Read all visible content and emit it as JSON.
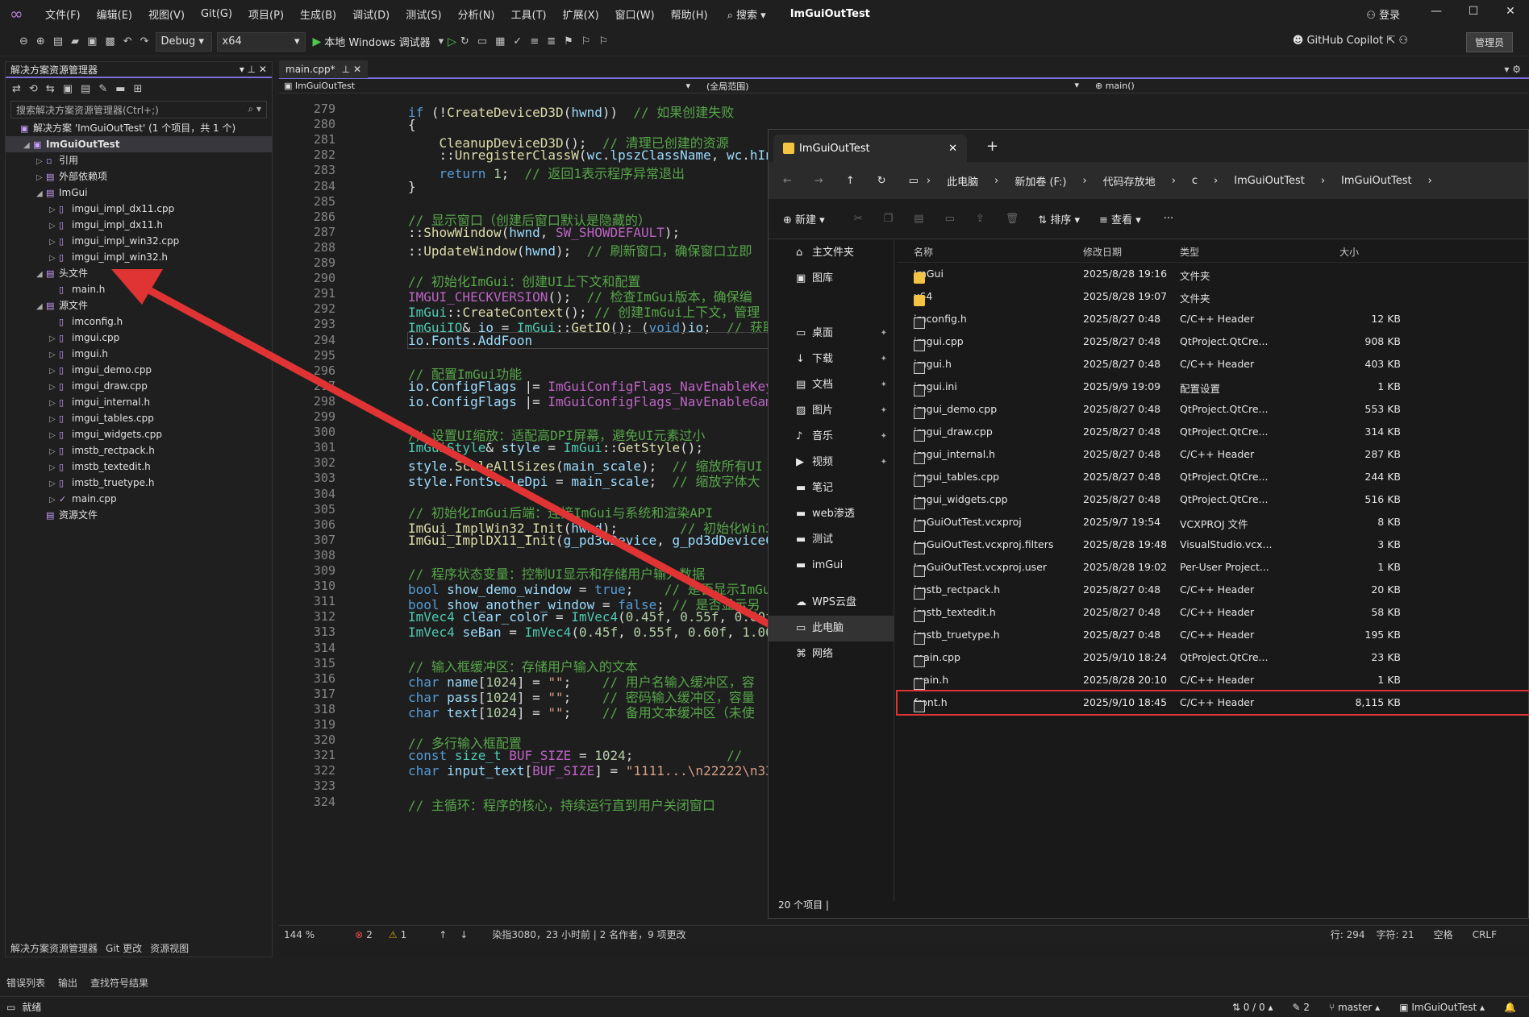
{
  "menu": [
    "文件(F)",
    "编辑(E)",
    "视图(V)",
    "Git(G)",
    "项目(P)",
    "生成(B)",
    "调试(D)",
    "测试(S)",
    "分析(N)",
    "工具(T)",
    "扩展(X)",
    "窗口(W)",
    "帮助(H)"
  ],
  "search_label": "搜索",
  "window_title": "ImGuiOutTest",
  "login": "登录",
  "toolbar": {
    "config": "Debug",
    "platform": "x64",
    "debugger": "本地 Windows 调试器",
    "copilot": "GitHub Copilot",
    "admin": "管理员"
  },
  "solution_explorer": {
    "title": "解决方案资源管理器",
    "search_placeholder": "搜索解决方案资源管理器(Ctrl+;)",
    "items": [
      {
        "label": "解决方案 'ImGuiOutTest' (1 个项目，共 1 个)",
        "indent": 0,
        "arrow": "",
        "icon": "▣"
      },
      {
        "label": "ImGuiOutTest",
        "indent": 1,
        "arrow": "◢",
        "icon": "▣",
        "sel": true
      },
      {
        "label": "引用",
        "indent": 2,
        "arrow": "▷",
        "icon": "▫"
      },
      {
        "label": "外部依赖项",
        "indent": 2,
        "arrow": "▷",
        "icon": "▤"
      },
      {
        "label": "ImGui",
        "indent": 2,
        "arrow": "◢",
        "icon": "▤"
      },
      {
        "label": "imgui_impl_dx11.cpp",
        "indent": 3,
        "arrow": "▷",
        "icon": "▯"
      },
      {
        "label": "imgui_impl_dx11.h",
        "indent": 3,
        "arrow": "▷",
        "icon": "▯"
      },
      {
        "label": "imgui_impl_win32.cpp",
        "indent": 3,
        "arrow": "▷",
        "icon": "▯"
      },
      {
        "label": "imgui_impl_win32.h",
        "indent": 3,
        "arrow": "▷",
        "icon": "▯"
      },
      {
        "label": "头文件",
        "indent": 2,
        "arrow": "◢",
        "icon": "▤"
      },
      {
        "label": "main.h",
        "indent": 3,
        "arrow": "",
        "icon": "▯"
      },
      {
        "label": "源文件",
        "indent": 2,
        "arrow": "◢",
        "icon": "▤"
      },
      {
        "label": "imconfig.h",
        "indent": 3,
        "arrow": "",
        "icon": "▯"
      },
      {
        "label": "imgui.cpp",
        "indent": 3,
        "arrow": "▷",
        "icon": "▯"
      },
      {
        "label": "imgui.h",
        "indent": 3,
        "arrow": "▷",
        "icon": "▯"
      },
      {
        "label": "imgui_demo.cpp",
        "indent": 3,
        "arrow": "▷",
        "icon": "▯"
      },
      {
        "label": "imgui_draw.cpp",
        "indent": 3,
        "arrow": "▷",
        "icon": "▯"
      },
      {
        "label": "imgui_internal.h",
        "indent": 3,
        "arrow": "▷",
        "icon": "▯"
      },
      {
        "label": "imgui_tables.cpp",
        "indent": 3,
        "arrow": "▷",
        "icon": "▯"
      },
      {
        "label": "imgui_widgets.cpp",
        "indent": 3,
        "arrow": "▷",
        "icon": "▯"
      },
      {
        "label": "imstb_rectpack.h",
        "indent": 3,
        "arrow": "▷",
        "icon": "▯"
      },
      {
        "label": "imstb_textedit.h",
        "indent": 3,
        "arrow": "▷",
        "icon": "▯"
      },
      {
        "label": "imstb_truetype.h",
        "indent": 3,
        "arrow": "▷",
        "icon": "▯"
      },
      {
        "label": "main.cpp",
        "indent": 3,
        "arrow": "▷",
        "icon": "✓"
      },
      {
        "label": "资源文件",
        "indent": 2,
        "arrow": "",
        "icon": "▤"
      }
    ],
    "bottom_tabs": [
      "解决方案资源管理器",
      "Git 更改",
      "资源视图"
    ]
  },
  "editor": {
    "tab": "main.cpp*",
    "nav_project": "ImGuiOutTest",
    "nav_scope": "(全局范围)",
    "nav_func": "main()",
    "zoom": "144 %",
    "errors": "2",
    "warnings": "1",
    "git_info": "染指3080，23 小时前 | 2 名作者，9 项更改",
    "pos_line": "行: 294",
    "pos_char": "字符: 21",
    "ws": "空格",
    "eol": "CRLF"
  },
  "code_lines": [
    {
      "n": "279",
      "html": "<span class='k'>if</span> (!<span class='f'>CreateDeviceD3D</span>(<span class='v'>hwnd</span>))  <span class='c'>// 如果创建失败</span>"
    },
    {
      "n": "280",
      "html": "{"
    },
    {
      "n": "281",
      "html": "    <span class='f'>CleanupDeviceD3D</span>();  <span class='c'>// 清理已创建的资源</span>"
    },
    {
      "n": "282",
      "html": "    ::<span class='f'>UnregisterClassW</span>(<span class='v'>wc</span>.<span class='v'>lpszClassName</span>, <span class='v'>wc</span>.<span class='v'>hIns</span>"
    },
    {
      "n": "283",
      "html": "    <span class='k'>return</span> <span class='n'>1</span>;  <span class='c'>// 返回1表示程序异常退出</span>"
    },
    {
      "n": "284",
      "html": "}"
    },
    {
      "n": "285",
      "html": ""
    },
    {
      "n": "286",
      "html": "<span class='c'>// 显示窗口（创建后窗口默认是隐藏的）</span>"
    },
    {
      "n": "287",
      "html": "::<span class='f'>ShowWindow</span>(<span class='v'>hwnd</span>, <span class='m'>SW_SHOWDEFAULT</span>);"
    },
    {
      "n": "288",
      "html": "::<span class='f'>UpdateWindow</span>(<span class='v'>hwnd</span>);  <span class='c'>// 刷新窗口，确保窗口立即</span>"
    },
    {
      "n": "289",
      "html": ""
    },
    {
      "n": "290",
      "html": "<span class='c'>// 初始化ImGui：创建UI上下文和配置</span>"
    },
    {
      "n": "291",
      "html": "<span class='m'>IMGUI_CHECKVERSION</span>();  <span class='c'>// 检查ImGui版本，确保编</span>"
    },
    {
      "n": "292",
      "html": "<span class='t2'>ImGui</span>::<span class='f'>CreateContext</span>(); <span class='c'>// 创建ImGui上下文，管理</span>"
    },
    {
      "n": "293",
      "html": "<span class='t2'>ImGuiIO</span>&amp; <span class='v'>io</span> = <span class='t2'>ImGui</span>::<span class='f'>GetIO</span>(); (<span class='k'>void</span>)<span class='v'>io</span>;  <span class='c'>// 获取</span>"
    },
    {
      "n": "294",
      "html": "<span class='v'>io</span>.<span class='v'>Fonts</span>.<span class='v'>AddFoon</span>"
    },
    {
      "n": "295",
      "html": ""
    },
    {
      "n": "296",
      "html": "<span class='c'>// 配置ImGui功能</span>"
    },
    {
      "n": "297",
      "html": "<span class='v'>io</span>.<span class='v'>ConfigFlags</span> |= <span class='m'>ImGuiConfigFlags_NavEnableKeyb</span>"
    },
    {
      "n": "298",
      "html": "<span class='v'>io</span>.<span class='v'>ConfigFlags</span> |= <span class='m'>ImGuiConfigFlags_NavEnableGame</span>"
    },
    {
      "n": "299",
      "html": ""
    },
    {
      "n": "300",
      "html": "<span class='c'>// 设置UI缩放：适配高DPI屏幕，避免UI元素过小</span>"
    },
    {
      "n": "301",
      "html": "<span class='t2'>ImGuiStyle</span>&amp; <span class='v'>style</span> = <span class='t2'>ImGui</span>::<span class='f'>GetStyle</span>();"
    },
    {
      "n": "302",
      "html": "<span class='v'>style</span>.<span class='f'>ScaleAllSizes</span>(<span class='v'>main_scale</span>);  <span class='c'>// 缩放所有UI</span>"
    },
    {
      "n": "303",
      "html": "<span class='v'>style</span>.<span class='v'>FontScaleDpi</span> = <span class='v'>main_scale</span>;  <span class='c'>// 缩放字体大</span>"
    },
    {
      "n": "304",
      "html": ""
    },
    {
      "n": "305",
      "html": "<span class='c'>// 初始化ImGui后端：连接ImGui与系统和渲染API</span>"
    },
    {
      "n": "306",
      "html": "<span class='f'>ImGui_ImplWin32_Init</span>(<span class='v'>hwnd</span>);        <span class='c'>// 初始化Win32</span>"
    },
    {
      "n": "307",
      "html": "<span class='f'>ImGui_ImplDX11_Init</span>(<span class='v'>g_pd3dDevice</span>, <span class='v'>g_pd3dDeviceCo</span>"
    },
    {
      "n": "308",
      "html": ""
    },
    {
      "n": "309",
      "html": "<span class='c'>// 程序状态变量：控制UI显示和存储用户输入数据</span>"
    },
    {
      "n": "310",
      "html": "<span class='k'>bool</span> <span class='v'>show_demo_window</span> = <span class='k'>true</span>;    <span class='c'>// 是否显示ImGu</span>"
    },
    {
      "n": "311",
      "html": "<span class='k'>bool</span> <span class='v'>show_another_window</span> = <span class='k'>false</span>; <span class='c'>// 是否显示另</span>"
    },
    {
      "n": "312",
      "html": "<span class='t2'>ImVec4</span> <span class='v'>clear_color</span> = <span class='t2'>ImVec4</span>(<span class='n'>0.45f</span>, <span class='n'>0.55f</span>, <span class='n'>0.60f</span>,"
    },
    {
      "n": "313",
      "html": "<span class='t2'>ImVec4</span> <span class='v'>seBan</span> = <span class='t2'>ImVec4</span>(<span class='n'>0.45f</span>, <span class='n'>0.55f</span>, <span class='n'>0.60f</span>, <span class='n'>1.00f</span>"
    },
    {
      "n": "314",
      "html": ""
    },
    {
      "n": "315",
      "html": "<span class='c'>// 输入框缓冲区：存储用户输入的文本</span>"
    },
    {
      "n": "316",
      "html": "<span class='k'>char</span> <span class='v'>name</span>[<span class='n'>1024</span>] = <span class='s'>\"\"</span>;    <span class='c'>// 用户名输入缓冲区，容</span>"
    },
    {
      "n": "317",
      "html": "<span class='k'>char</span> <span class='v'>pass</span>[<span class='n'>1024</span>] = <span class='s'>\"\"</span>;    <span class='c'>// 密码输入缓冲区，容量</span>"
    },
    {
      "n": "318",
      "html": "<span class='k'>char</span> <span class='v'>text</span>[<span class='n'>1024</span>] = <span class='s'>\"\"</span>;    <span class='c'>// 备用文本缓冲区（未使</span>"
    },
    {
      "n": "319",
      "html": ""
    },
    {
      "n": "320",
      "html": "<span class='c'>// 多行输入框配置</span>"
    },
    {
      "n": "321",
      "html": "<span class='k'>const</span> <span class='t2'>size_t</span> <span class='m'>BUF_SIZE</span> = <span class='n'>1024</span>;            <span class='c'>//</span>"
    },
    {
      "n": "322",
      "html": "<span class='k'>char</span> <span class='v'>input_text</span>[<span class='m'>BUF_SIZE</span>] = <span class='s'>\"1111...\\n22222\\n333</span>"
    },
    {
      "n": "323",
      "html": ""
    },
    {
      "n": "324",
      "html": "<span class='c'>// 主循环：程序的核心，持续运行直到用户关闭窗口</span>"
    }
  ],
  "file_explorer": {
    "tab_title": "ImGuiOutTest",
    "breadcrumb": [
      "此电脑",
      "新加卷 (F:)",
      "代码存放地",
      "c",
      "ImGuiOutTest",
      "ImGuiOutTest"
    ],
    "cmd_new": "新建",
    "cmd_sort": "排序",
    "cmd_view": "查看",
    "headers": [
      "名称",
      "修改日期",
      "类型",
      "大小"
    ],
    "nav": [
      {
        "label": "主文件夹",
        "icon": "⌂",
        "pin": false
      },
      {
        "label": "图库",
        "icon": "▣",
        "pin": false
      },
      {
        "label": "桌面",
        "icon": "▭",
        "pin": true
      },
      {
        "label": "下载",
        "icon": "↓",
        "pin": true
      },
      {
        "label": "文档",
        "icon": "▤",
        "pin": true
      },
      {
        "label": "图片",
        "icon": "▨",
        "pin": true
      },
      {
        "label": "音乐",
        "icon": "♪",
        "pin": true
      },
      {
        "label": "视频",
        "icon": "▶",
        "pin": true
      },
      {
        "label": "笔记",
        "icon": "▬",
        "pin": false
      },
      {
        "label": "web渗透",
        "icon": "▬",
        "pin": false
      },
      {
        "label": "测试",
        "icon": "▬",
        "pin": false
      },
      {
        "label": "imGui",
        "icon": "▬",
        "pin": false
      },
      {
        "label": "WPS云盘",
        "icon": "☁",
        "pin": false
      },
      {
        "label": "此电脑",
        "icon": "▭",
        "pin": false
      },
      {
        "label": "网络",
        "icon": "⌘",
        "pin": false
      }
    ],
    "files": [
      {
        "name": "ImGui",
        "date": "2025/8/28 19:16",
        "type": "文件夹",
        "size": "",
        "folder": true
      },
      {
        "name": "x64",
        "date": "2025/8/28 19:07",
        "type": "文件夹",
        "size": "",
        "folder": true
      },
      {
        "name": "imconfig.h",
        "date": "2025/8/27 0:48",
        "type": "C/C++ Header",
        "size": "12 KB"
      },
      {
        "name": "imgui.cpp",
        "date": "2025/8/27 0:48",
        "type": "QtProject.QtCre...",
        "size": "908 KB"
      },
      {
        "name": "imgui.h",
        "date": "2025/8/27 0:48",
        "type": "C/C++ Header",
        "size": "403 KB"
      },
      {
        "name": "imgui.ini",
        "date": "2025/9/9 19:09",
        "type": "配置设置",
        "size": "1 KB"
      },
      {
        "name": "imgui_demo.cpp",
        "date": "2025/8/27 0:48",
        "type": "QtProject.QtCre...",
        "size": "553 KB"
      },
      {
        "name": "imgui_draw.cpp",
        "date": "2025/8/27 0:48",
        "type": "QtProject.QtCre...",
        "size": "314 KB"
      },
      {
        "name": "imgui_internal.h",
        "date": "2025/8/27 0:48",
        "type": "C/C++ Header",
        "size": "287 KB"
      },
      {
        "name": "imgui_tables.cpp",
        "date": "2025/8/27 0:48",
        "type": "QtProject.QtCre...",
        "size": "244 KB"
      },
      {
        "name": "imgui_widgets.cpp",
        "date": "2025/8/27 0:48",
        "type": "QtProject.QtCre...",
        "size": "516 KB"
      },
      {
        "name": "ImGuiOutTest.vcxproj",
        "date": "2025/9/7 19:54",
        "type": "VCXPROJ 文件",
        "size": "8 KB"
      },
      {
        "name": "ImGuiOutTest.vcxproj.filters",
        "date": "2025/8/28 19:48",
        "type": "VisualStudio.vcx...",
        "size": "3 KB"
      },
      {
        "name": "ImGuiOutTest.vcxproj.user",
        "date": "2025/8/28 19:02",
        "type": "Per-User Project...",
        "size": "1 KB"
      },
      {
        "name": "imstb_rectpack.h",
        "date": "2025/8/27 0:48",
        "type": "C/C++ Header",
        "size": "20 KB"
      },
      {
        "name": "imstb_textedit.h",
        "date": "2025/8/27 0:48",
        "type": "C/C++ Header",
        "size": "58 KB"
      },
      {
        "name": "imstb_truetype.h",
        "date": "2025/8/27 0:48",
        "type": "C/C++ Header",
        "size": "195 KB"
      },
      {
        "name": "main.cpp",
        "date": "2025/9/10 18:24",
        "type": "QtProject.QtCre...",
        "size": "23 KB"
      },
      {
        "name": "main.h",
        "date": "2025/8/28 20:10",
        "type": "C/C++ Header",
        "size": "1 KB"
      },
      {
        "name": "front.h",
        "date": "2025/9/10 18:45",
        "type": "C/C++ Header",
        "size": "8,115 KB",
        "highlight": true
      }
    ],
    "item_count": "20 个项目"
  },
  "output_tabs": [
    "错误列表",
    "输出",
    "查找符号结果"
  ],
  "status": {
    "ready": "就绪",
    "changes": "0 / 0",
    "edits": "2",
    "branch": "master",
    "repo": "ImGuiOutTest"
  },
  "colors": {
    "accent": "#7a6fdb",
    "annotation": "#e03434",
    "folder": "#f4c342"
  }
}
